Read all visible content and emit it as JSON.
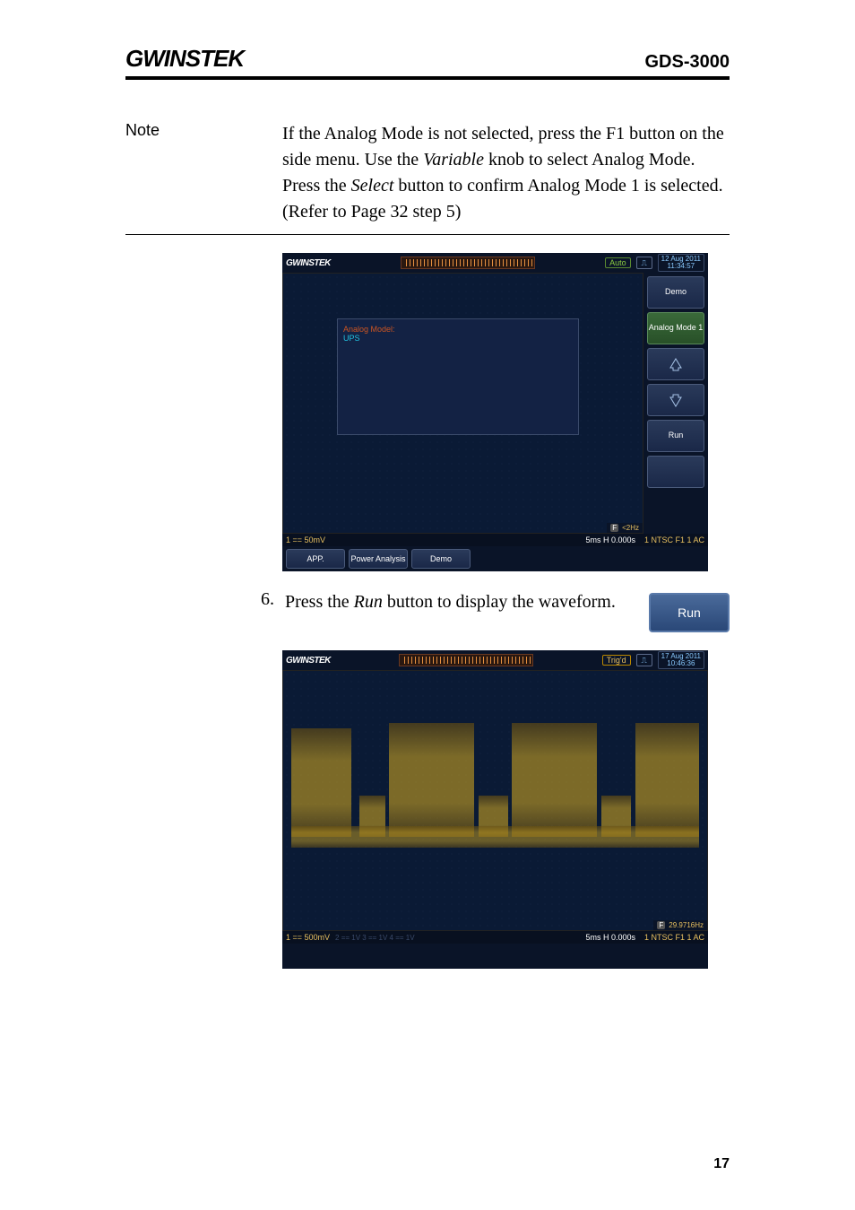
{
  "header": {
    "logo": "GWINSTEK",
    "model": "GDS-3000"
  },
  "note": {
    "label": "Note",
    "text_a": "If the Analog Mode is not selected, press the F1 button on the side menu. Use the ",
    "var1": "Variable",
    "text_b": " knob to select Analog Mode. Press the ",
    "var2": "Select",
    "text_c": " button to confirm Analog Mode 1 is selected. (Refer to Page 32 step 5)"
  },
  "step6": {
    "num": "6.",
    "text_a": "Press the ",
    "var": "Run",
    "text_b": " button to display the waveform.",
    "btn": "Run"
  },
  "scope1": {
    "logo": "GWINSTEK",
    "status": "Auto",
    "date": "12 Aug 2011",
    "time": "11:34:57",
    "side": {
      "demo": "Demo",
      "analog": "Analog Mode 1",
      "run": "Run"
    },
    "bottom": {
      "app": "APP.",
      "pa": "Power Analysis",
      "demo": "Demo"
    },
    "analog_box": {
      "l1": "Analog Model:",
      "l2": "UPS"
    },
    "statusbar": {
      "ch": "1 == 50mV",
      "timebase": "5ms  H  0.000s",
      "trig": "1 NTSC F1  1        AC"
    },
    "freq": "<2Hz"
  },
  "scope2": {
    "logo": "GWINSTEK",
    "status": "Trig'd",
    "date": "17 Aug 2011",
    "time": "10:46:36",
    "statusbar": {
      "ch": "1 == 500mV",
      "ch2": "2 ==  1V   3 ==  1V   4 ==  1V",
      "timebase": "5ms  H  0.000s",
      "trig": "1 NTSC F1  1        AC"
    },
    "freq": "29.9716Hz"
  },
  "page_num": "17"
}
